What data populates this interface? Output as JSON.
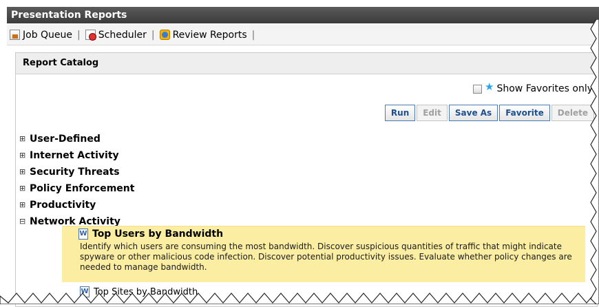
{
  "window": {
    "title": "Presentation Reports"
  },
  "toolbar": {
    "items": [
      {
        "label": "Job Queue",
        "icon": "job-queue-icon"
      },
      {
        "label": "Scheduler",
        "icon": "scheduler-icon"
      },
      {
        "label": "Review Reports",
        "icon": "review-reports-icon"
      }
    ]
  },
  "catalog": {
    "title": "Report Catalog",
    "favorites_label": "Show Favorites only",
    "buttons": [
      {
        "label": "Run",
        "enabled": true
      },
      {
        "label": "Edit",
        "enabled": false
      },
      {
        "label": "Save As",
        "enabled": true
      },
      {
        "label": "Favorite",
        "enabled": true
      },
      {
        "label": "Delete",
        "enabled": false
      }
    ],
    "tree": [
      {
        "label": "User-Defined",
        "state": "⊞"
      },
      {
        "label": "Internet Activity",
        "state": "⊞"
      },
      {
        "label": "Security Threats",
        "state": "⊞"
      },
      {
        "label": "Policy Enforcement",
        "state": "⊞"
      },
      {
        "label": "Productivity",
        "state": "⊞"
      },
      {
        "label": "Network Activity",
        "state": "⊟"
      }
    ],
    "selected_report": {
      "title": "Top Users by Bandwidth",
      "description": "Identify which users are consuming the most bandwidth. Discover suspicious quantities of traffic that might indicate spyware or other malicious code infection. Discover potential productivity issues. Evaluate whether policy changes are needed to manage bandwidth."
    },
    "next_report": {
      "title": "Top Sites by Bandwidth"
    }
  },
  "colors": {
    "highlight": "#fbeea3",
    "titlebar": "#444444",
    "button_text": "#1b4f8f"
  }
}
